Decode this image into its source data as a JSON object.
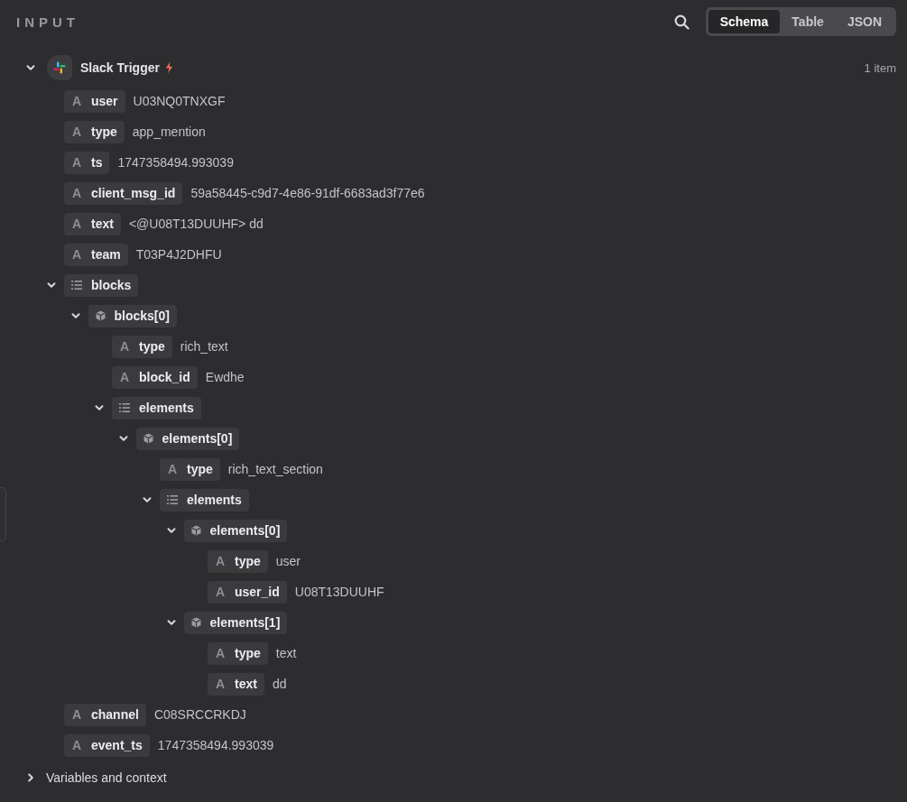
{
  "header": {
    "title": "INPUT"
  },
  "view_tabs": [
    {
      "label": "Schema",
      "selected": true
    },
    {
      "label": "Table",
      "selected": false
    },
    {
      "label": "JSON",
      "selected": false
    }
  ],
  "tree": {
    "label": "Slack Trigger",
    "expanded": true,
    "count": "1 item",
    "children": [
      {
        "kind": "string",
        "icon": "A",
        "key": "user",
        "value": "U03NQ0TNXGF"
      },
      {
        "kind": "string",
        "icon": "A",
        "key": "type",
        "value": "app_mention"
      },
      {
        "kind": "string",
        "icon": "A",
        "key": "ts",
        "value": "1747358494.993039"
      },
      {
        "kind": "string",
        "icon": "A",
        "key": "client_msg_id",
        "value": "59a58445-c9d7-4e86-91df-6683ad3f77e6"
      },
      {
        "kind": "string",
        "icon": "A",
        "key": "text",
        "value": "<@U08T13DUUHF> dd"
      },
      {
        "kind": "string",
        "icon": "A",
        "key": "team",
        "value": "T03P4J2DHFU"
      },
      {
        "kind": "array",
        "key": "blocks",
        "expanded": true,
        "children": [
          {
            "kind": "object",
            "key": "blocks[0]",
            "expanded": true,
            "children": [
              {
                "kind": "string",
                "icon": "A",
                "key": "type",
                "value": "rich_text"
              },
              {
                "kind": "string",
                "icon": "A",
                "key": "block_id",
                "value": "Ewdhe"
              },
              {
                "kind": "array",
                "key": "elements",
                "expanded": true,
                "children": [
                  {
                    "kind": "object",
                    "key": "elements[0]",
                    "expanded": true,
                    "children": [
                      {
                        "kind": "string",
                        "icon": "A",
                        "key": "type",
                        "value": "rich_text_section"
                      },
                      {
                        "kind": "array",
                        "key": "elements",
                        "expanded": true,
                        "children": [
                          {
                            "kind": "object",
                            "key": "elements[0]",
                            "expanded": true,
                            "children": [
                              {
                                "kind": "string",
                                "icon": "A",
                                "key": "type",
                                "value": "user"
                              },
                              {
                                "kind": "string",
                                "icon": "A",
                                "key": "user_id",
                                "value": "U08T13DUUHF"
                              }
                            ]
                          },
                          {
                            "kind": "object",
                            "key": "elements[1]",
                            "expanded": true,
                            "children": [
                              {
                                "kind": "string",
                                "icon": "A",
                                "key": "type",
                                "value": "text"
                              },
                              {
                                "kind": "string",
                                "icon": "A",
                                "key": "text",
                                "value": "dd"
                              }
                            ]
                          }
                        ]
                      }
                    ]
                  }
                ]
              }
            ]
          }
        ]
      },
      {
        "kind": "string",
        "icon": "A",
        "key": "channel",
        "value": "C08SRCCRKDJ"
      },
      {
        "kind": "string",
        "icon": "A",
        "key": "event_ts",
        "value": "1747358494.993039"
      }
    ]
  },
  "footer_section": {
    "label": "Variables and context",
    "expanded": false
  }
}
